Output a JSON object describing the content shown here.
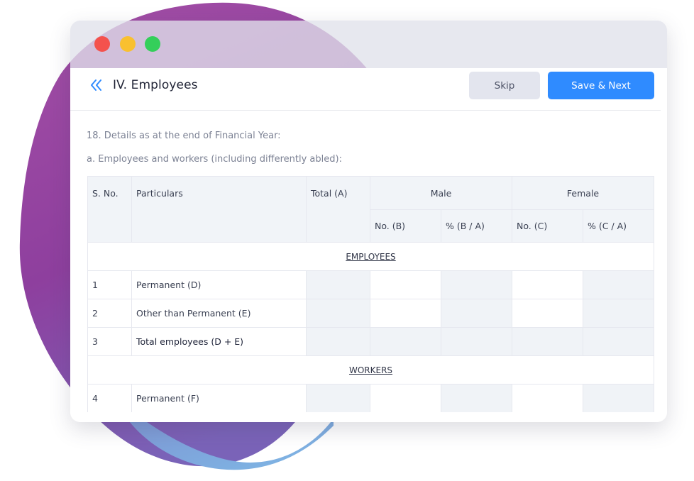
{
  "colors": {
    "accent": "#2f8bff",
    "close": "#f4524d",
    "minimize": "#f9c02f",
    "maximize": "#34cf5a",
    "blob_purple": "#9b4ba9",
    "blob_blue": "#6fa9e0"
  },
  "window": {
    "controls": [
      "close-icon",
      "minimize-icon",
      "maximize-icon"
    ]
  },
  "header": {
    "back_icon": "double-chevron-left-icon",
    "title": "IV. Employees",
    "skip_label": "Skip",
    "save_label": "Save & Next"
  },
  "form": {
    "question": "18. Details as at the end of Financial Year:",
    "subquestion": "a. Employees and workers (including differently abled):"
  },
  "table": {
    "headers": {
      "sno": "S. No.",
      "particulars": "Particulars",
      "total": "Total (A)",
      "male": "Male",
      "female": "Female",
      "male_no": "No. (B)",
      "male_pct": "% (B / A)",
      "female_no": "No. (C)",
      "female_pct": "% (C / A)"
    },
    "sections": [
      {
        "title": "EMPLOYEES",
        "rows": [
          {
            "sno": "1",
            "label": "Permanent (D)"
          },
          {
            "sno": "2",
            "label": "Other than Permanent (E)"
          },
          {
            "sno": "3",
            "label": "Total employees (D + E)"
          }
        ]
      },
      {
        "title": "WORKERS",
        "rows": [
          {
            "sno": "4",
            "label": "Permanent (F)"
          }
        ]
      }
    ]
  }
}
